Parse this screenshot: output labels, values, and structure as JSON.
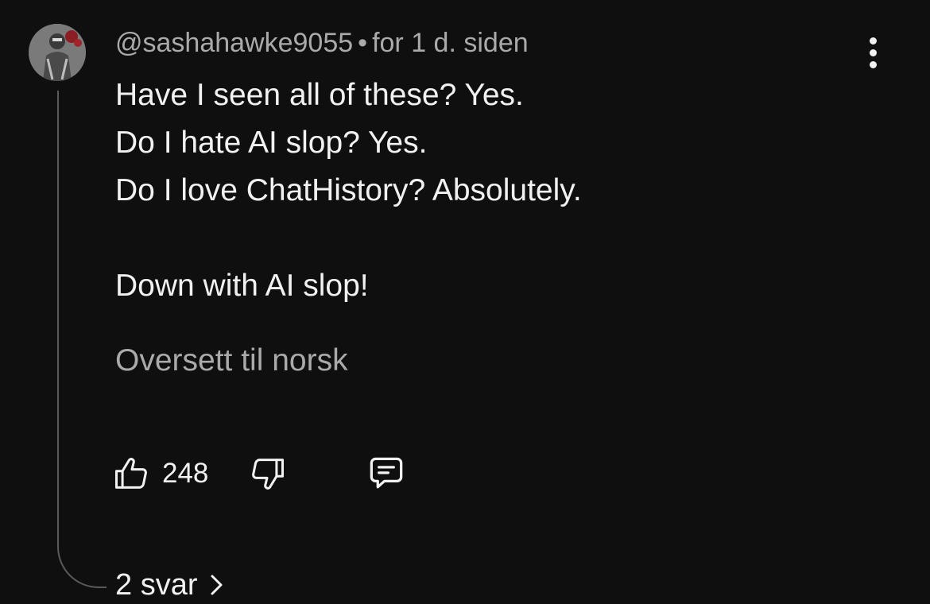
{
  "comment": {
    "author": "@sashahawke9055",
    "separator": "•",
    "timestamp": "for 1 d. siden",
    "lines": [
      "Have I seen all of these? Yes.",
      "Do I hate AI slop? Yes.",
      "Do I love ChatHistory? Absolutely.",
      "",
      "Down with AI slop!"
    ],
    "translate_label": "Oversett til norsk",
    "like_count": "248",
    "replies_label": "2 svar"
  },
  "icons": {
    "more": "more-vertical-icon",
    "like": "thumbs-up-icon",
    "dislike": "thumbs-down-icon",
    "reply": "comment-icon",
    "replies": "chevron-right-icon"
  },
  "colors": {
    "background": "#0f0f0f",
    "text_primary": "#f1f1f1",
    "text_secondary": "#aaaaaa",
    "thread_line": "#5a5a5a"
  }
}
